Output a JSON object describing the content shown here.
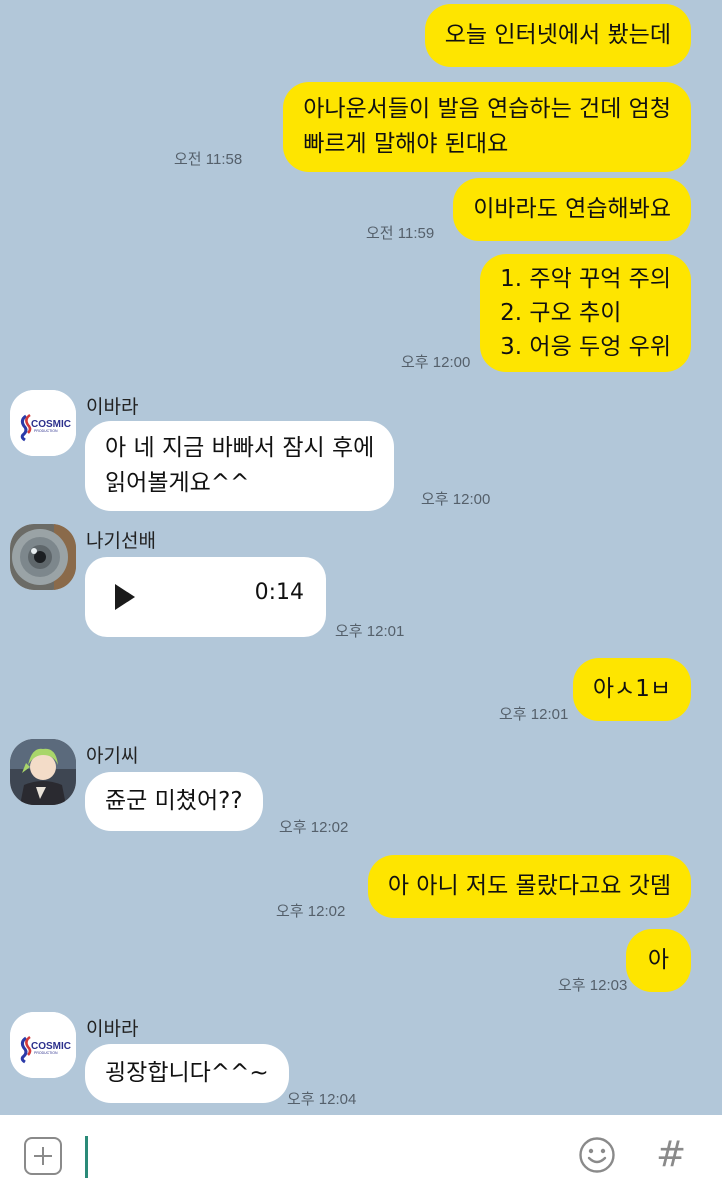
{
  "messages": {
    "m1": {
      "text": "오늘 인터넷에서 봤는데"
    },
    "m2": {
      "line1": "아나운서들이 발음 연습하는 건데 엄청",
      "line2": "빠르게 말해야 된대요",
      "time": "오전 11:58"
    },
    "m3": {
      "text": "이바라도 연습해봐요",
      "time": "오전 11:59"
    },
    "m4": {
      "line1": "1. 주악 꾸억 주의",
      "line2": "2. 구오 추이",
      "line3": "3. 어응 두엉 우위",
      "time": "오후 12:00"
    },
    "m5": {
      "sender": "이바라",
      "line1": "아 네 지금 바빠서 잠시 후에",
      "line2": "읽어볼게요^^",
      "time": "오후 12:00"
    },
    "m6": {
      "sender": "나기선배",
      "duration": "0:14",
      "time": "오후 12:01"
    },
    "m7": {
      "text": "아ㅅ1ㅂ",
      "time": "오후 12:01"
    },
    "m8": {
      "sender": "아기씨",
      "text": "쥰군 미쳤어??",
      "time": "오후 12:02"
    },
    "m9": {
      "text": "아 아니 저도 몰랐다고요 갓뎀",
      "time": "오후 12:02"
    },
    "m10": {
      "text": "아",
      "time": "오후 12:03"
    },
    "m11": {
      "sender": "이바라",
      "text": "굉장합니다^^~",
      "time": "오후 12:04"
    }
  },
  "avatars": {
    "ibara_logo": "COSMIC",
    "ibara_logo_sub": "PRODUCTION"
  },
  "input": {
    "add_icon": "plus-square-icon",
    "emoji_icon": "smile-icon",
    "hash_label": "#"
  },
  "colors": {
    "background": "#b2c7d9",
    "my_bubble": "#fee500",
    "other_bubble": "#ffffff"
  }
}
